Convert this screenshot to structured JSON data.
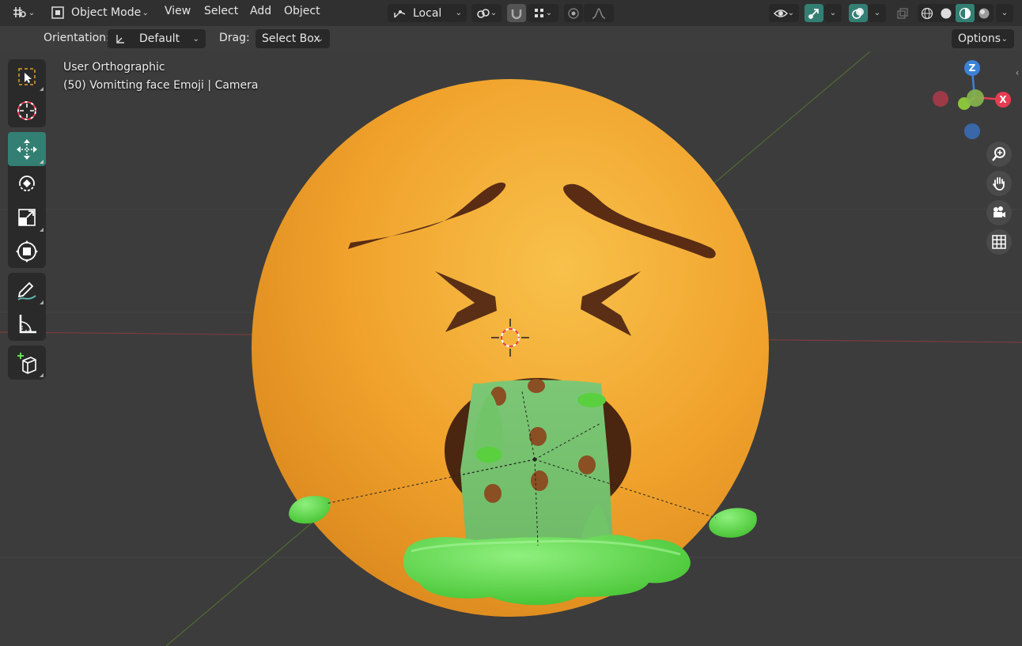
{
  "header": {
    "mode_label": "Object Mode",
    "menus": [
      "View",
      "Select",
      "Add",
      "Object"
    ],
    "transform_orientation": "Local"
  },
  "tool_settings": {
    "orientation_label": "Orientation:",
    "orientation_value": "Default",
    "drag_label": "Drag:",
    "drag_value": "Select Box",
    "options_label": "Options"
  },
  "viewport": {
    "view_name": "User Orthographic",
    "object_info": "(50) Vomitting face Emoji | Camera"
  },
  "gizmo": {
    "z_label": "Z",
    "x_label": "X"
  },
  "toolbar": {
    "tools": [
      "select-box",
      "cursor",
      "move",
      "rotate",
      "scale",
      "transform",
      "annotate",
      "measure",
      "add-cube"
    ],
    "active_tool": "move"
  },
  "colors": {
    "accent": "#337f73",
    "x_axis": "#e63d52",
    "y_axis": "#8bc43b",
    "z_axis": "#3c82d9",
    "emoji_face": "#f2a531",
    "vomit_green": "#6ad95a"
  }
}
